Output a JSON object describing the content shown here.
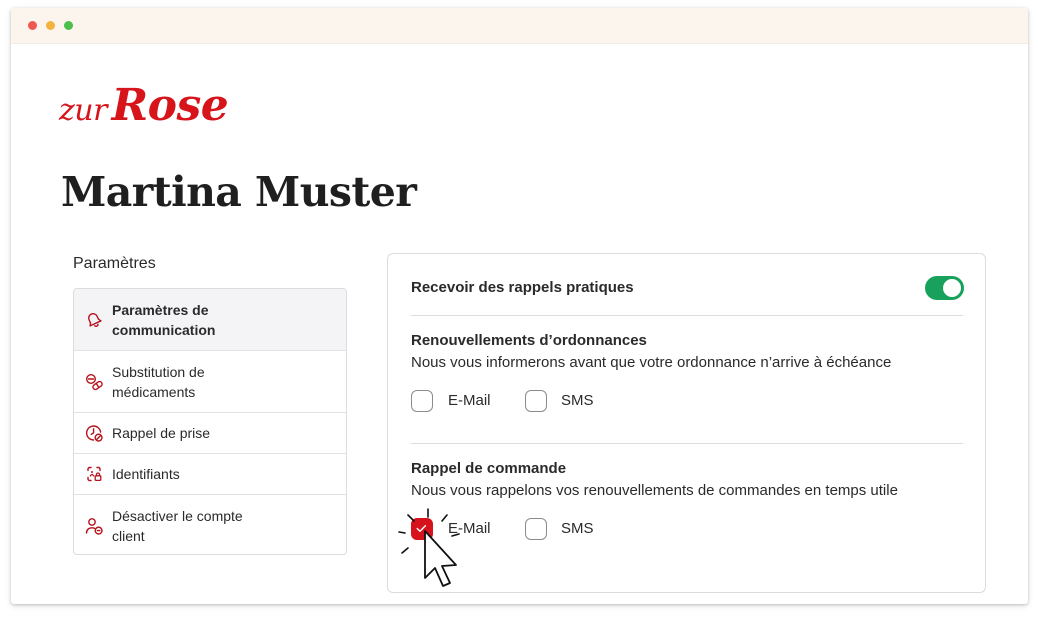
{
  "window": {
    "traffic_lights": [
      "red",
      "yellow",
      "green"
    ]
  },
  "brand": {
    "logo_word1": "zur",
    "logo_word2": "Rose",
    "color": "#d8141b"
  },
  "page": {
    "title": "Martina Muster"
  },
  "sidebar": {
    "heading": "Paramètres",
    "items": [
      {
        "label": "Paramètres de communication",
        "icon": "bell-icon",
        "active": true
      },
      {
        "label": "Substitution de médicaments",
        "icon": "pills-icon",
        "active": false
      },
      {
        "label": "Rappel de prise",
        "icon": "clock-icon",
        "active": false
      },
      {
        "label": "Identifiants",
        "icon": "id-icon",
        "active": false
      },
      {
        "label": "Désactiver le compte client",
        "icon": "user-remove-icon",
        "active": false
      }
    ]
  },
  "panel": {
    "reminders": {
      "label": "Recevoir des rappels pratiques",
      "enabled": true,
      "toggle_color": "#17a15a"
    },
    "sections": [
      {
        "title": "Renouvellements d’ordonnances",
        "description": "Nous vous informerons avant que votre ordonnance n’arrive à échéance",
        "options": [
          {
            "label": "E-Mail",
            "checked": false
          },
          {
            "label": "SMS",
            "checked": false
          }
        ]
      },
      {
        "title": "Rappel de commande",
        "description": "Nous vous rappelons vos renouvellements de commandes en temps utile",
        "options": [
          {
            "label": "E-Mail",
            "checked": true
          },
          {
            "label": "SMS",
            "checked": false
          }
        ]
      }
    ],
    "check_color": "#d6131d"
  }
}
